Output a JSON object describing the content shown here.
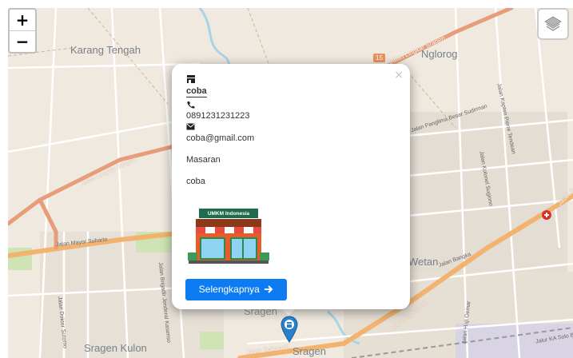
{
  "map": {
    "places": {
      "karang_tengah": "Karang Tengah",
      "nglorog": "Nglorog",
      "wetan": "Wetan",
      "sragen_kulon": "Sragen Kulon",
      "sragen": "Sragen",
      "sragen_partial": "Sragen"
    },
    "roads": {
      "lingkar_sragen_top": "Jalan Lingkar Sragen",
      "lingkar_sragen_left": "Jalan Lingkar Sragen",
      "mayor_suharto": "Jalan Mayor Suharto",
      "sukowati_right": "Jalan Sukowati",
      "sukowati_bottom": "Jalan Sukowati",
      "panglima_sudirman": "Jalan Panglima Besar Sudirman",
      "kapten_tendean": "Jalan Kapten Pierre Tendean",
      "kolonel_sugiono": "Jalan Kolonel Sugiono",
      "brigjen_katamso": "Jalan Brigadir Jenderal Katamso",
      "dokter_sutomo": "Jalan Dokter Sutomo",
      "haji_oemar": "Jalan Haji Oemar",
      "bangka": "Jalan Bangka",
      "ka_solo": "Jalur KA Solo Ba",
      "right_edge": "Jalan S"
    },
    "route_shield": "15"
  },
  "controls": {
    "zoom_in": "+",
    "zoom_out": "−"
  },
  "popup": {
    "close": "×",
    "name": "coba",
    "phone": "0891231231223",
    "email": "coba@gmail.com",
    "location": "Masaran",
    "description": "coba",
    "image_title": "UMKM Indonesia",
    "button_label": "Selengkapnya"
  },
  "icons": {
    "shop": "store-icon",
    "phone": "phone-icon",
    "email": "envelope-icon",
    "button": "arrow-right-icon",
    "layers": "layers-icon",
    "marker": "map-marker-icon"
  }
}
